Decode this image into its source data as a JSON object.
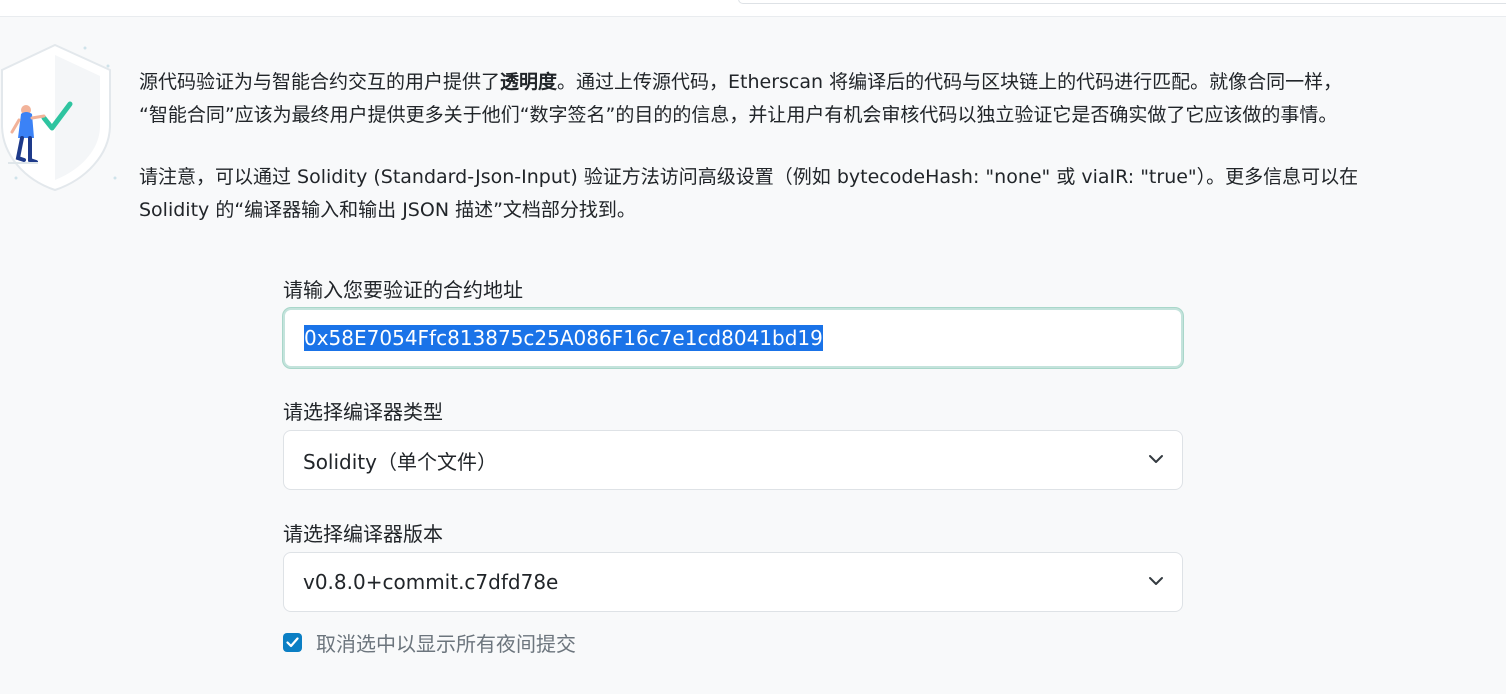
{
  "intro": {
    "line1_a": "源代码验证为与智能合约交互的用户提供了",
    "line1_bold": "透明度",
    "line1_b": "。通过上传源代码，Etherscan 将编译后的代码与区块链上的代码进行匹配。就像合同一样，",
    "line2": "“智能合同”应该为最终用户提供更多关于他们“数字签名”的目的的信息，并让用户有机会审核代码以独立验证它是否确实做了它应该做的事情。",
    "note_line1": "请注意，可以通过 Solidity (Standard-Json-Input) 验证方法访问高级设置（例如 bytecodeHash: \"none\" 或 viaIR: \"true\"）。更多信息可以在",
    "note_line2": "Solidity 的“编译器输入和输出 JSON 描述”文档部分找到。"
  },
  "form": {
    "address_label": "请输入您要验证的合约地址",
    "address_value": "0x58E7054Ffc813875c25A086F16c7e1cd8041bd19",
    "compiler_type_label": "请选择编译器类型",
    "compiler_type_value": "Solidity（单个文件）",
    "compiler_version_label": "请选择编译器版本",
    "compiler_version_value": "v0.8.0+commit.c7dfd78e",
    "nightly_checkbox_label": "取消选中以显示所有夜间提交",
    "nightly_checked": true
  },
  "icons": [
    "shield-icon",
    "checkmark-icon",
    "chevron-down-icon",
    "checkbox-check-icon"
  ],
  "colors": {
    "accent_checkbox": "#0b7fc4",
    "selection_highlight": "#1a73e8",
    "focus_border": "#c4e3dc",
    "illustration_green": "#2ec4a0",
    "illustration_person": "#3b82f6"
  }
}
